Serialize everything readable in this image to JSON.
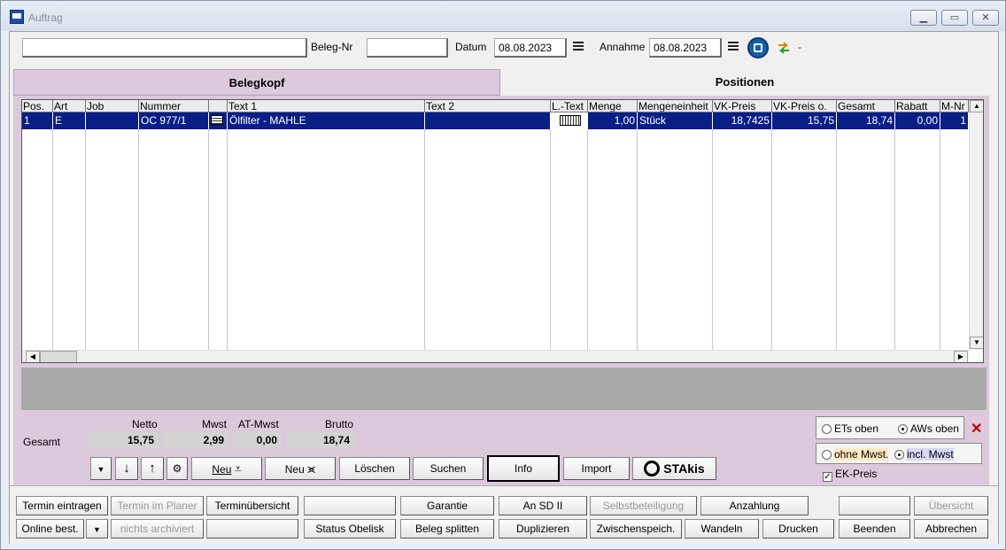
{
  "window": {
    "title": "Auftrag"
  },
  "topbar": {
    "customer_value": "",
    "beleg_label": "Beleg-Nr",
    "beleg_value": "",
    "datum_label": "Datum",
    "datum_value": "08.08.2023",
    "annahme_label": "Annahme",
    "annahme_value": "08.08.2023",
    "flag_text": "-"
  },
  "tabs": [
    {
      "label": "Belegkopf"
    },
    {
      "label": "Positionen"
    }
  ],
  "grid": {
    "columns": [
      "Pos.",
      "Art",
      "Job",
      "Nummer",
      "",
      "Text 1",
      "Text 2",
      "L.-Text",
      "Menge",
      "Mengeneinheit",
      "VK-Preis",
      "VK-Preis o.",
      "Gesamt",
      "Rabatt",
      "M-Nr"
    ],
    "rows": [
      {
        "pos": "1",
        "art": "E",
        "job": "",
        "nummer": "OC 977/1",
        "text1": "Ölfilter - MAHLE",
        "text2": "",
        "menge": "1,00",
        "einheit": "Stück",
        "vk": "18,7425",
        "vko": "15,75",
        "gesamt": "18,74",
        "rabatt": "0,00",
        "mnr": "1"
      }
    ]
  },
  "totals": {
    "gesamt_label": "Gesamt",
    "netto_label": "Netto",
    "netto": "15,75",
    "mwst_label": "Mwst",
    "mwst": "2,99",
    "atmwst_label": "AT-Mwst",
    "atmwst": "0,00",
    "brutto_label": "Brutto",
    "brutto": "18,74"
  },
  "actions": {
    "neu1": "Neu",
    "neu2": "Neu",
    "loeschen": "Löschen",
    "suchen": "Suchen",
    "info": "Info",
    "import": "Import",
    "stakis": "STAkis"
  },
  "options": {
    "ets_oben": "ETs oben",
    "aws_oben": "AWs oben",
    "ohne_mwst": "ohne Mwst.",
    "incl_mwst": "incl. Mwst",
    "ek_preis": "EK-Preis"
  },
  "bottom_row1": [
    "Termin eintragen",
    "Termin im Planer",
    "Terminübersicht",
    "",
    "Garantie",
    "An SD II",
    "Selbstbeteiligung",
    "Anzahlung",
    "",
    "Übersicht"
  ],
  "bottom_row2": [
    "Online best.",
    "nichts archiviert",
    "",
    "Status Obelisk",
    "Beleg splitten",
    "Duplizieren",
    "Zwischenspeich.",
    "Wandeln",
    "Drucken",
    "Beenden",
    "Abbrechen"
  ]
}
